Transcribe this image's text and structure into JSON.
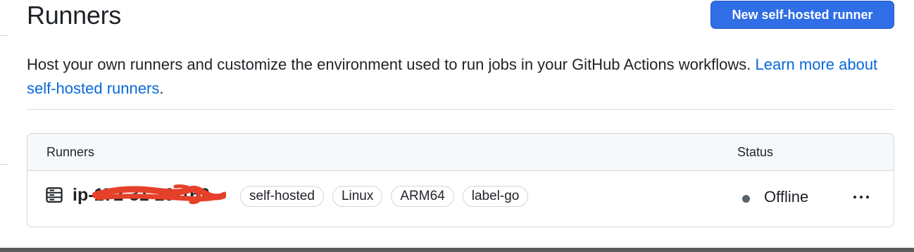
{
  "header": {
    "title": "Runners",
    "new_runner_label": "New self-hosted runner"
  },
  "description": {
    "text": "Host your own runners and customize the environment used to run jobs in your GitHub Actions workflows. ",
    "link_text": "Learn more about self-hosted runners",
    "suffix": "."
  },
  "table": {
    "col_runners": "Runners",
    "col_status": "Status",
    "runners": [
      {
        "icon": "server-icon",
        "name": "ip-172-31-29-162",
        "labels": [
          "self-hosted",
          "Linux",
          "ARM64",
          "label-go"
        ],
        "status": "Offline",
        "status_color": "#59636e"
      }
    ]
  },
  "colors": {
    "accent": "#2f6ee6",
    "link": "#0969da",
    "redaction": "#e5402a"
  }
}
